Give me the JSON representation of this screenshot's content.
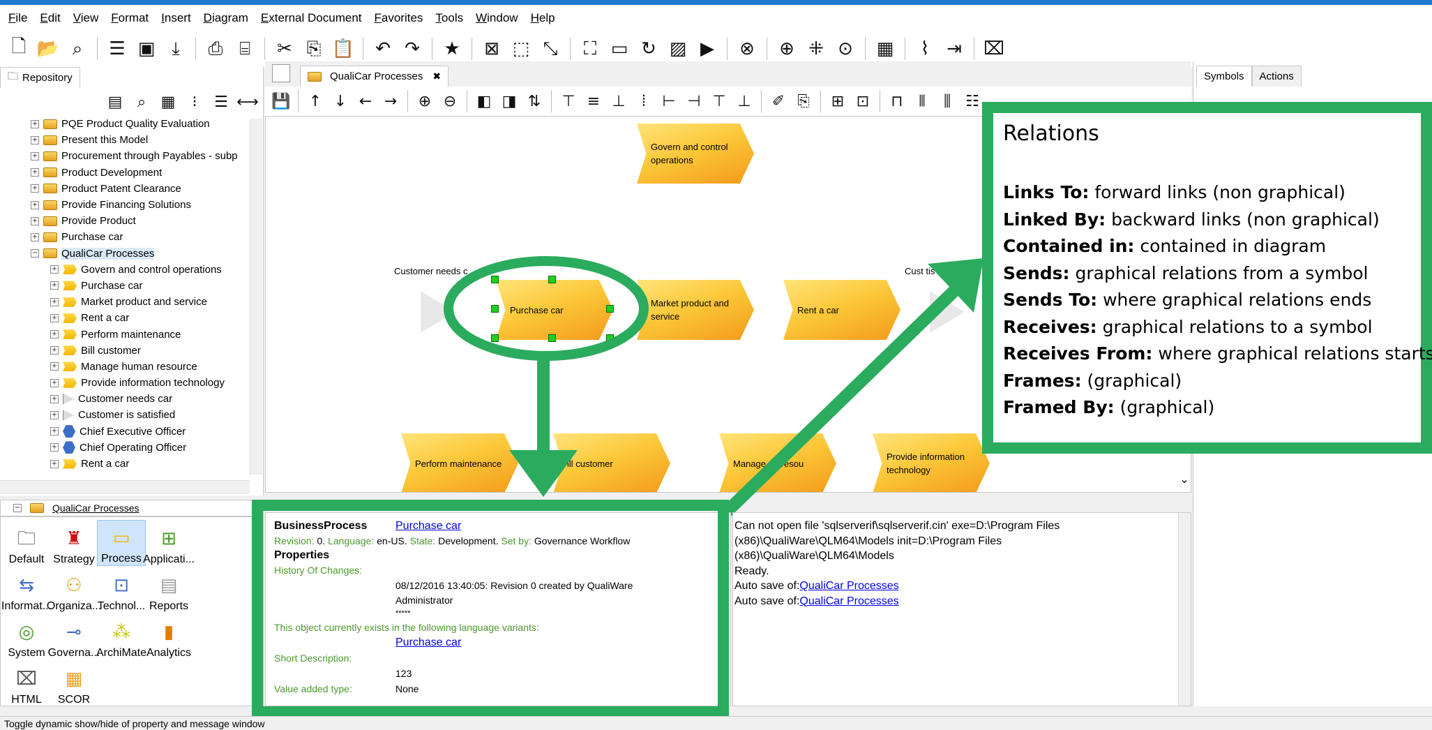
{
  "menu": [
    "File",
    "Edit",
    "View",
    "Format",
    "Insert",
    "Diagram",
    "External Document",
    "Favorites",
    "Tools",
    "Window",
    "Help"
  ],
  "left_tab": "Repository",
  "tree": [
    {
      "label": "PQE Product Quality Evaluation",
      "icon": "model",
      "indent": 1
    },
    {
      "label": "Present this Model",
      "icon": "model",
      "indent": 1
    },
    {
      "label": "Procurement through Payables - subp",
      "icon": "model",
      "indent": 1
    },
    {
      "label": "Product Development",
      "icon": "model",
      "indent": 1
    },
    {
      "label": "Product Patent Clearance",
      "icon": "model",
      "indent": 1
    },
    {
      "label": "Provide Financing Solutions",
      "icon": "model",
      "indent": 1
    },
    {
      "label": "Provide Product",
      "icon": "model",
      "indent": 1
    },
    {
      "label": "Purchase car",
      "icon": "model",
      "indent": 1
    },
    {
      "label": "QualiCar Processes",
      "icon": "model",
      "indent": 1,
      "expanded": true
    },
    {
      "label": "Govern and control operations",
      "icon": "proc",
      "indent": 2
    },
    {
      "label": "Purchase car",
      "icon": "proc",
      "indent": 2
    },
    {
      "label": "Market product and service",
      "icon": "proc",
      "indent": 2
    },
    {
      "label": "Rent a car",
      "icon": "proc",
      "indent": 2
    },
    {
      "label": "Perform maintenance",
      "icon": "proc",
      "indent": 2
    },
    {
      "label": "Bill customer",
      "icon": "proc",
      "indent": 2
    },
    {
      "label": "Manage human resource",
      "icon": "proc",
      "indent": 2
    },
    {
      "label": "Provide information technology",
      "icon": "proc",
      "indent": 2
    },
    {
      "label": "Customer needs car",
      "icon": "tri",
      "indent": 2
    },
    {
      "label": "Customer is satisfied",
      "icon": "tri",
      "indent": 2
    },
    {
      "label": "Chief Executive Officer",
      "icon": "hex",
      "indent": 2
    },
    {
      "label": "Chief Operating Officer",
      "icon": "hex",
      "indent": 2
    },
    {
      "label": "Rent a car",
      "icon": "proc",
      "indent": 2
    }
  ],
  "diagram_tab": "QualiCar Processes",
  "canvas": {
    "govern": "Govern and control operations",
    "purchase": "Purchase  car",
    "market": "Market product and service",
    "rent": "Rent a car",
    "perform": "Perform maintenance",
    "bill": "ill  customer",
    "manage": "Manage    an resou",
    "provide": "Provide   information technology",
    "event_left_label": "Customer  needs c",
    "event_right_label": "Cust    tis"
  },
  "right_tabs": [
    "Symbols",
    "Actions"
  ],
  "bottom_left_header": "QualiCar Processes",
  "palette": [
    {
      "label": "Default",
      "icon": "folder"
    },
    {
      "label": "Strategy",
      "icon": "strategy"
    },
    {
      "label": "Process",
      "icon": "process",
      "selected": true
    },
    {
      "label": "Applicati...",
      "icon": "application"
    },
    {
      "label": "Informat...",
      "icon": "information"
    },
    {
      "label": "Organiza...",
      "icon": "organization"
    },
    {
      "label": "Technol...",
      "icon": "technology"
    },
    {
      "label": "Reports",
      "icon": "reports"
    },
    {
      "label": "System",
      "icon": "system"
    },
    {
      "label": "Governa...",
      "icon": "governance"
    },
    {
      "label": "ArchiMate",
      "icon": "archimate"
    },
    {
      "label": "Analytics",
      "icon": "analytics"
    },
    {
      "label": "HTML",
      "icon": "html"
    },
    {
      "label": "SCOR",
      "icon": "scor"
    }
  ],
  "props": {
    "type": "BusinessProcess",
    "name_link": "Purchase car",
    "revision_label": "Revision:",
    "revision_value": "0.",
    "language_label": "Language:",
    "language_value": "en-US.",
    "state_label": "State:",
    "state_value": "Development.",
    "setby_label": "Set by:",
    "setby_value": "Governance Workflow",
    "properties_heading": "Properties",
    "history_label": "History Of Changes:",
    "history_line1": "08/12/2016 13:40:05: Revision 0 created by QualiWare",
    "history_line2": "Administrator",
    "history_line3": "*****",
    "variants_label": "This object currently exists in the following language variants:",
    "variant_link": "Purchase car",
    "short_desc_label": "Short Description:",
    "short_desc_value": "123",
    "value_added_label": "Value added type:",
    "value_added_value": "None"
  },
  "messages": {
    "line1": "Can not open file 'sqlserverif\\sqlserverif.cin' exe=D:\\Program Files",
    "line2": "(x86)\\QualiWare\\QLM64\\Models init=D:\\Program Files",
    "line3": "(x86)\\QualiWare\\QLM64\\Models",
    "line4": "Ready.",
    "autosave_prefix": "Auto save of:",
    "autosave_link": "QualiCar Processes"
  },
  "status": "Toggle dynamic show/hide of property and message window",
  "overlay": {
    "title": "Relations",
    "lines": [
      {
        "key": "Links To:",
        "text": " forward links (non graphical)"
      },
      {
        "key": "Linked By:",
        "text": " backward links (non graphical)"
      },
      {
        "key": "Contained in:",
        "text": " contained in diagram"
      },
      {
        "key": "Sends:",
        "text": " graphical relations from a symbol"
      },
      {
        "key": "Sends To:",
        "text": " where graphical relations ends"
      },
      {
        "key": "Receives:",
        "text": " graphical relations to a symbol"
      },
      {
        "key": "Receives From:",
        "text": " where graphical relations starts"
      },
      {
        "key": "Frames:",
        "text": " (graphical)"
      },
      {
        "key": "Framed By:",
        "text": " (graphical)"
      }
    ]
  },
  "colors": {
    "accent_green": "#2bab5d",
    "title_blue": "#1f78d1",
    "process_yellow": "#fcc83a"
  }
}
